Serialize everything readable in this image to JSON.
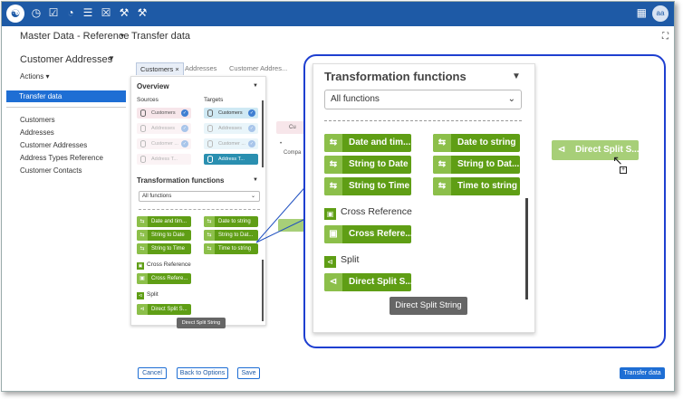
{
  "header": {
    "app_icon": "database-icon",
    "nav_icons": [
      "clock-icon",
      "checkbox-icon",
      "gauge-icon",
      "list-icon",
      "task-icon",
      "gavel-icon",
      "wrench-icon"
    ],
    "avatar_initials": "aa"
  },
  "breadcrumb": {
    "item1": "Master Data - Reference",
    "item2": "Transfer data"
  },
  "sidebar": {
    "title": "Customer Addresses",
    "actions": "Actions",
    "selected": "Transfer data",
    "items": [
      "Customers",
      "Addresses",
      "Customer Addresses",
      "Address Types Reference",
      "Customer Contacts"
    ]
  },
  "tabs": [
    "Customers",
    "Addresses",
    "Customer Addres..."
  ],
  "overview": {
    "title": "Overview",
    "sources_label": "Sources",
    "targets_label": "Targets",
    "sources": [
      "Customers",
      "Addresses",
      "Customer ...",
      "Address T..."
    ],
    "targets": [
      "Customers",
      "Addresses",
      "Customer ...",
      "Address T..."
    ]
  },
  "transformation": {
    "title": "Transformation functions",
    "select_value": "All functions",
    "functions": [
      "Date and tim...",
      "Date to string",
      "String to Date",
      "String to Dat...",
      "String to Time",
      "Time to string"
    ],
    "cross_reference_label": "Cross Reference",
    "cross_reference_fn": "Cross Refere...",
    "split_label": "Split",
    "split_fn": "Direct Split S...",
    "tooltip": "Direct Split String"
  },
  "canvas": {
    "node_title": "Cu",
    "node_field": "Compa"
  },
  "drag": {
    "ghost_label": "Direct Split S..."
  },
  "footer": {
    "cancel": "Cancel",
    "back": "Back to Options",
    "save": "Save",
    "transfer": "Transfer data"
  },
  "colors": {
    "topbar": "#1e5aa6",
    "function_green": "#5f9e15",
    "zoom_border": "#1e3fd0"
  }
}
